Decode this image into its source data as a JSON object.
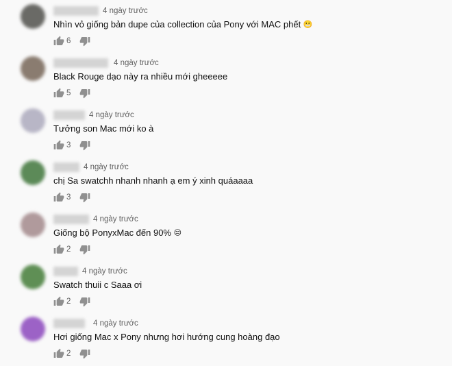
{
  "comments": [
    {
      "timestamp": "4 ngày trước",
      "text": "Nhìn vỏ giống bản dupe của collection của Pony với MAC phết",
      "emoji": "😬",
      "likes": "6",
      "avatar_color": "#6a6a66"
    },
    {
      "timestamp": "4 ngày trước",
      "text": "Black Rouge dạo này ra nhiều mới gheeeee",
      "emoji": "",
      "likes": "5",
      "avatar_color": "#8a7c70"
    },
    {
      "timestamp": "4 ngày trước",
      "text": "Tưởng son Mac mới ko à",
      "emoji": "",
      "likes": "3",
      "avatar_color": "#b8b6c6"
    },
    {
      "timestamp": "4 ngày trước",
      "text": "chị Sa swatchh nhanh nhanh ạ em ý xinh quáaaaa",
      "emoji": "",
      "likes": "3",
      "avatar_color": "#5c8a58"
    },
    {
      "timestamp": "4 ngày trước",
      "text": "Giống bộ PonyxMac đến 90%",
      "emoji": "😒",
      "likes": "2",
      "avatar_color": "#b09a9c"
    },
    {
      "timestamp": "4 ngày trước",
      "text": "Swatch thuii c Saaa ơi",
      "emoji": "",
      "likes": "2",
      "avatar_color": "#5f8f55"
    },
    {
      "timestamp": "4 ngày trước",
      "text": "Hơi giống Mac x Pony nhưng hơi hướng cung hoàng đạo",
      "emoji": "",
      "likes": "2",
      "avatar_color": "#9c62c6"
    }
  ],
  "icons": {
    "like": "thumb-up-icon",
    "dislike": "thumb-down-icon"
  },
  "colors": {
    "background": "#f9f9f9",
    "text": "#0f0f0f",
    "secondary_text": "#606060",
    "icon": "#909090"
  }
}
